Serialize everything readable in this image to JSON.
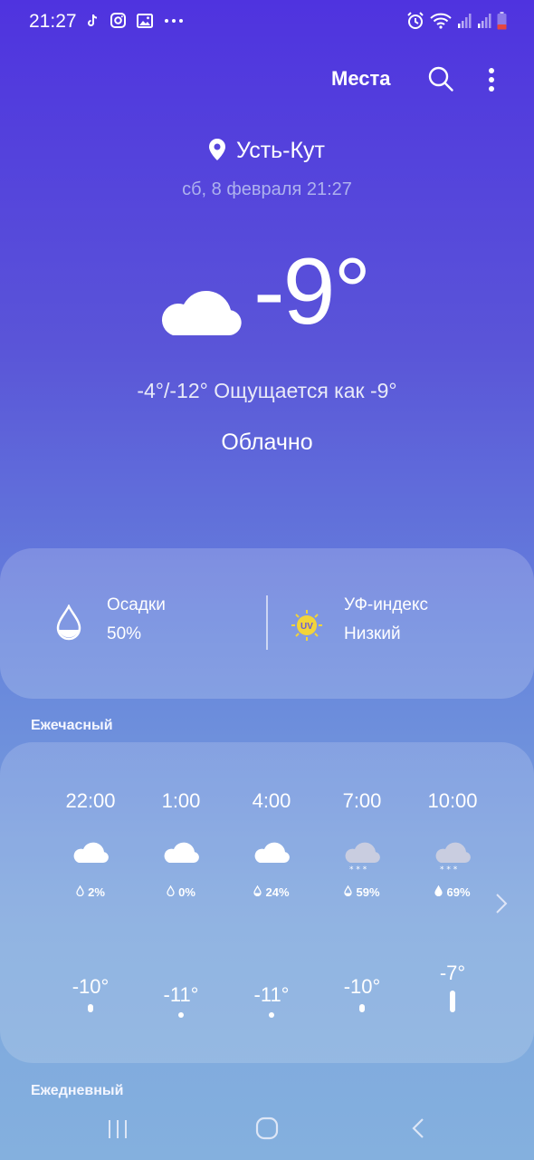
{
  "status_bar": {
    "time": "21:27",
    "notif_icons": [
      "tiktok-icon",
      "instagram-icon",
      "gallery-icon",
      "more-notifications-icon"
    ],
    "right_icons": [
      "alarm-icon",
      "wifi-icon",
      "signal-icon",
      "signal-icon",
      "battery-icon"
    ]
  },
  "header": {
    "places_label": "Места"
  },
  "location": {
    "city": "Усть-Кут",
    "datetime": "сб, 8 февраля 21:27"
  },
  "current": {
    "icon": "cloud-icon",
    "temperature": "-9°",
    "minmax_feels": "-4°/-12° Ощущается как -9°",
    "condition": "Облачно"
  },
  "details": {
    "precip_label": "Осадки",
    "precip_value": "50%",
    "uv_label": "УФ-индекс",
    "uv_value": "Низкий",
    "uv_badge": "UV"
  },
  "hourly": {
    "title": "Ежечасный",
    "items": [
      {
        "time": "22:00",
        "icon": "cloud-icon",
        "precip": "2%",
        "temp": "-10°",
        "level": 0.1
      },
      {
        "time": "1:00",
        "icon": "cloud-icon",
        "precip": "0%",
        "temp": "-11°",
        "level": 0.0
      },
      {
        "time": "4:00",
        "icon": "cloud-icon",
        "precip": "24%",
        "temp": "-11°",
        "level": 0.0
      },
      {
        "time": "7:00",
        "icon": "snow-cloud-icon",
        "precip": "59%",
        "temp": "-10°",
        "level": 0.1
      },
      {
        "time": "10:00",
        "icon": "snow-cloud-icon",
        "precip": "69%",
        "temp": "-7°",
        "level": 0.6
      }
    ]
  },
  "daily": {
    "title": "Ежедневный"
  },
  "colors": {
    "bg_top": "#4f33df",
    "bg_bottom": "#84b0de",
    "uv_yellow": "#f2d43a",
    "snow_cloud": "#c9cde0"
  }
}
